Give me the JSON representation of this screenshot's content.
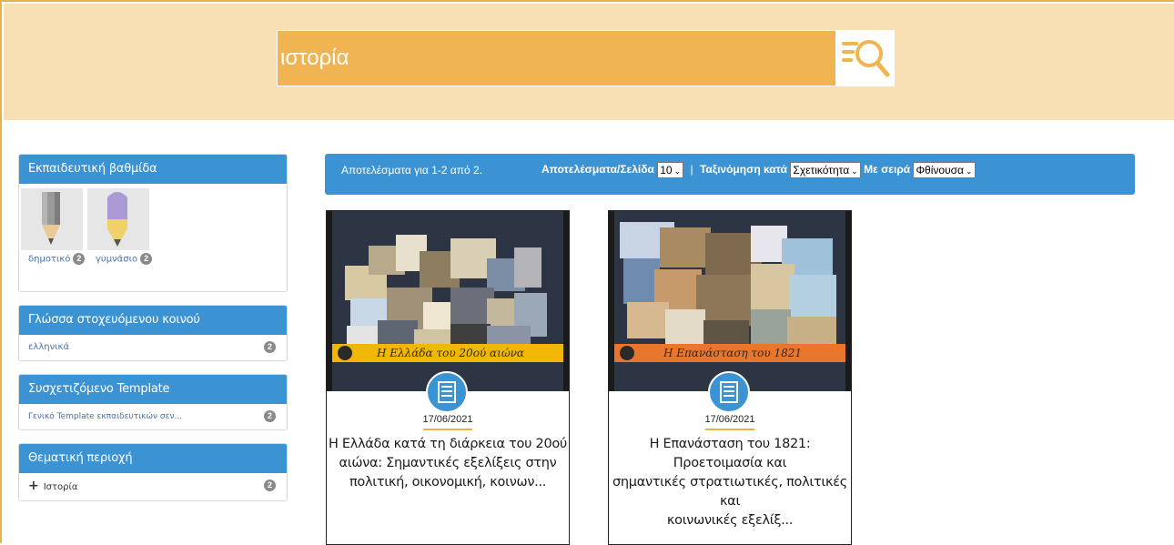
{
  "search": {
    "value": "ιστορία",
    "button_icon": "search-list-icon"
  },
  "sidebar": {
    "level": {
      "title": "Εκπαιδευτική βαθμίδα",
      "items": [
        {
          "label": "δημοτικό",
          "count": "2",
          "icon": "pencil-icon"
        },
        {
          "label": "γυμνάσιο",
          "count": "2",
          "icon": "pen-icon"
        }
      ]
    },
    "language": {
      "title": "Γλώσσα στοχευόμενου κοινού",
      "items": [
        {
          "label": "ελληνικά",
          "count": "2"
        }
      ]
    },
    "template": {
      "title": "Συσχετιζόμενο Template",
      "items": [
        {
          "label": "Γενικό Template εκπαιδευτικών σεν...",
          "count": "2"
        }
      ]
    },
    "subject": {
      "title": "Θεματική περιοχή",
      "items": [
        {
          "label": "Ιστορία",
          "count": "2",
          "icon": "plus-icon"
        }
      ]
    }
  },
  "results": {
    "count_text": "Αποτελέσματα για 1-2 από 2.",
    "per_page_label": "Αποτελέσματα/Σελίδα",
    "per_page_value": "10",
    "separator": "|",
    "sort_label": "Ταξινόμηση κατά",
    "sort_value": "Σχετικότητα",
    "order_label": "Με σειρά",
    "order_value": "Φθίνουσα"
  },
  "cards": [
    {
      "banner": "Η Ελλάδα του 20ού αιώνα",
      "banner_color": "#f2b705",
      "date": "17/06/2021",
      "title_lines": [
        "Η Ελλάδα κατά τη διάρκεια του 20ού",
        "αιώνα: Σημαντικές εξελίξεις στην",
        "πολιτική, οικονομική, κοινων..."
      ],
      "icon": "document-list-icon"
    },
    {
      "banner": "Η Επανάσταση του 1821",
      "banner_color": "#e8762c",
      "date": "17/06/2021",
      "title_lines": [
        "Η Επανάσταση του 1821: Προετοιμασία και",
        "σημαντικές στρατιωτικές, πολιτικές και",
        "κοινωνικές εξελίξ..."
      ],
      "icon": "document-list-icon"
    }
  ],
  "colors": {
    "accent": "#3b93d4",
    "header_bg": "#f8dfb4",
    "search_bg": "#f0b552",
    "badge": "#8a8a8a"
  }
}
